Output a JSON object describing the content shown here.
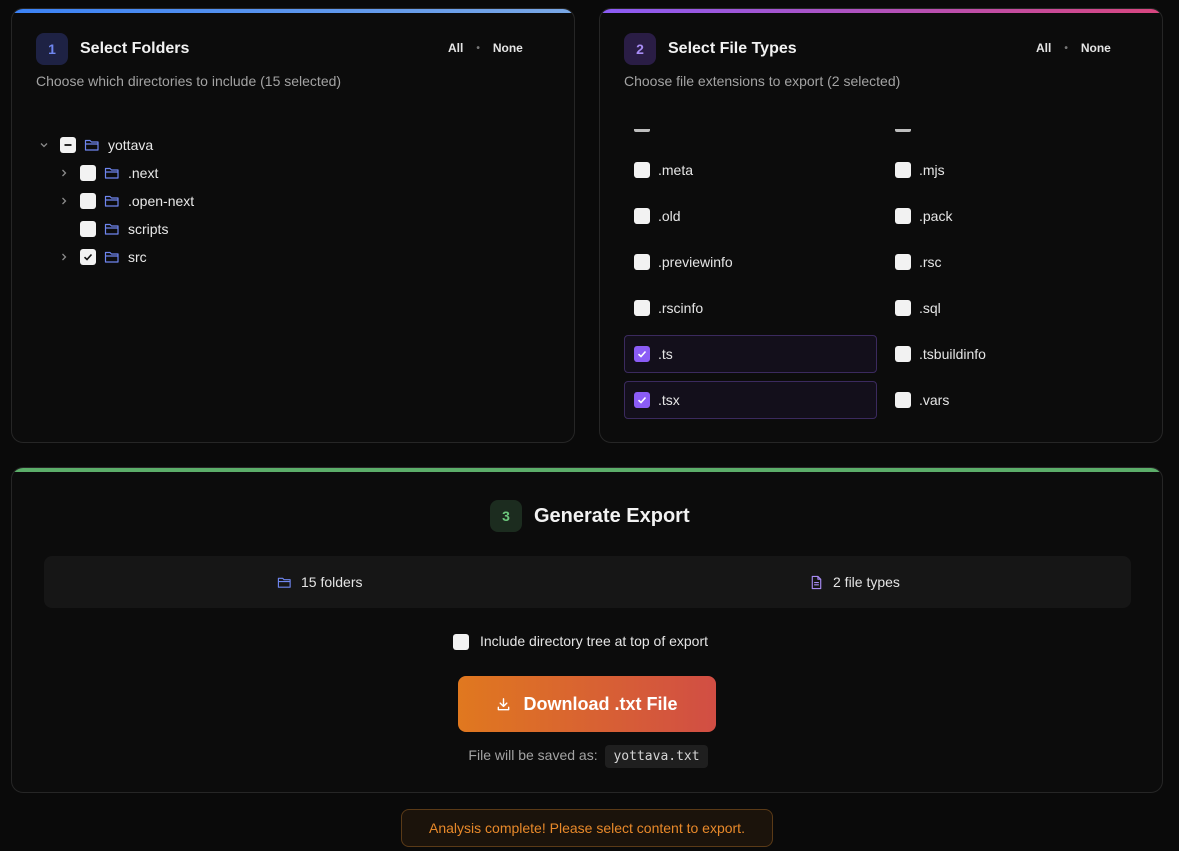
{
  "folders_card": {
    "step": "1",
    "title": "Select Folders",
    "subtitle": "Choose which directories to include (15 selected)",
    "all_label": "All",
    "none_label": "None",
    "tree": [
      {
        "name": "yottava",
        "state": "indeterminate"
      },
      {
        "name": ".next",
        "state": "unchecked"
      },
      {
        "name": ".open-next",
        "state": "unchecked"
      },
      {
        "name": "scripts",
        "state": "unchecked"
      },
      {
        "name": "src",
        "state": "checked"
      }
    ]
  },
  "types_card": {
    "step": "2",
    "title": "Select File Types",
    "subtitle": "Choose file extensions to export (2 selected)",
    "all_label": "All",
    "none_label": "None",
    "extensions_left": [
      {
        "ext": ".meta",
        "checked": false
      },
      {
        "ext": ".old",
        "checked": false
      },
      {
        "ext": ".previewinfo",
        "checked": false
      },
      {
        "ext": ".rscinfo",
        "checked": false
      },
      {
        "ext": ".ts",
        "checked": true
      },
      {
        "ext": ".tsx",
        "checked": true
      }
    ],
    "extensions_right": [
      {
        "ext": ".mjs",
        "checked": false
      },
      {
        "ext": ".pack",
        "checked": false
      },
      {
        "ext": ".rsc",
        "checked": false
      },
      {
        "ext": ".sql",
        "checked": false
      },
      {
        "ext": ".tsbuildinfo",
        "checked": false
      },
      {
        "ext": ".vars",
        "checked": false
      }
    ]
  },
  "export_card": {
    "step": "3",
    "title": "Generate Export",
    "folders_stat": "15 folders",
    "types_stat": "2 file types",
    "include_tree_label": "Include directory tree at top of export",
    "download_label": "Download .txt File",
    "saved_prefix": "File will be saved as:",
    "filename": "yottava.txt"
  },
  "status_message": "Analysis complete! Please select content to export.",
  "colors": {
    "blue_accent": "#6f86f0",
    "purple_accent": "#8b5cf6",
    "green_accent": "#5cae6a",
    "orange_gradient_start": "#e0781f",
    "orange_gradient_end": "#d14e44",
    "status_text": "#e8892a"
  },
  "icons": [
    "folder-icon",
    "chevron-right-icon",
    "chevron-down-icon",
    "check-icon",
    "minus-icon",
    "file-icon",
    "download-icon"
  ]
}
